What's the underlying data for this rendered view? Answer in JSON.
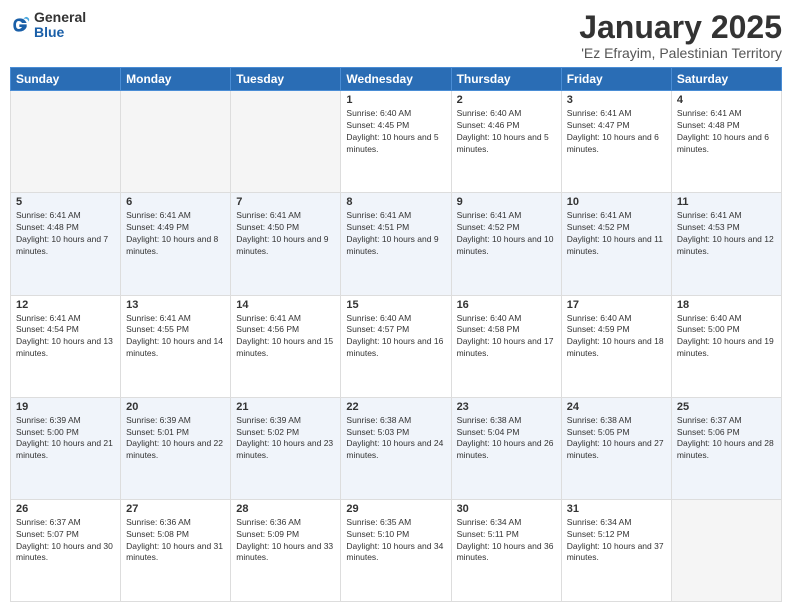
{
  "logo": {
    "general": "General",
    "blue": "Blue"
  },
  "header": {
    "title": "January 2025",
    "subtitle": "'Ez Efrayim, Palestinian Territory"
  },
  "weekdays": [
    "Sunday",
    "Monday",
    "Tuesday",
    "Wednesday",
    "Thursday",
    "Friday",
    "Saturday"
  ],
  "weeks": [
    [
      {
        "day": "",
        "sunrise": "",
        "sunset": "",
        "daylight": "",
        "empty": true
      },
      {
        "day": "",
        "sunrise": "",
        "sunset": "",
        "daylight": "",
        "empty": true
      },
      {
        "day": "",
        "sunrise": "",
        "sunset": "",
        "daylight": "",
        "empty": true
      },
      {
        "day": "1",
        "sunrise": "Sunrise: 6:40 AM",
        "sunset": "Sunset: 4:45 PM",
        "daylight": "Daylight: 10 hours and 5 minutes.",
        "empty": false
      },
      {
        "day": "2",
        "sunrise": "Sunrise: 6:40 AM",
        "sunset": "Sunset: 4:46 PM",
        "daylight": "Daylight: 10 hours and 5 minutes.",
        "empty": false
      },
      {
        "day": "3",
        "sunrise": "Sunrise: 6:41 AM",
        "sunset": "Sunset: 4:47 PM",
        "daylight": "Daylight: 10 hours and 6 minutes.",
        "empty": false
      },
      {
        "day": "4",
        "sunrise": "Sunrise: 6:41 AM",
        "sunset": "Sunset: 4:48 PM",
        "daylight": "Daylight: 10 hours and 6 minutes.",
        "empty": false
      }
    ],
    [
      {
        "day": "5",
        "sunrise": "Sunrise: 6:41 AM",
        "sunset": "Sunset: 4:48 PM",
        "daylight": "Daylight: 10 hours and 7 minutes.",
        "empty": false
      },
      {
        "day": "6",
        "sunrise": "Sunrise: 6:41 AM",
        "sunset": "Sunset: 4:49 PM",
        "daylight": "Daylight: 10 hours and 8 minutes.",
        "empty": false
      },
      {
        "day": "7",
        "sunrise": "Sunrise: 6:41 AM",
        "sunset": "Sunset: 4:50 PM",
        "daylight": "Daylight: 10 hours and 9 minutes.",
        "empty": false
      },
      {
        "day": "8",
        "sunrise": "Sunrise: 6:41 AM",
        "sunset": "Sunset: 4:51 PM",
        "daylight": "Daylight: 10 hours and 9 minutes.",
        "empty": false
      },
      {
        "day": "9",
        "sunrise": "Sunrise: 6:41 AM",
        "sunset": "Sunset: 4:52 PM",
        "daylight": "Daylight: 10 hours and 10 minutes.",
        "empty": false
      },
      {
        "day": "10",
        "sunrise": "Sunrise: 6:41 AM",
        "sunset": "Sunset: 4:52 PM",
        "daylight": "Daylight: 10 hours and 11 minutes.",
        "empty": false
      },
      {
        "day": "11",
        "sunrise": "Sunrise: 6:41 AM",
        "sunset": "Sunset: 4:53 PM",
        "daylight": "Daylight: 10 hours and 12 minutes.",
        "empty": false
      }
    ],
    [
      {
        "day": "12",
        "sunrise": "Sunrise: 6:41 AM",
        "sunset": "Sunset: 4:54 PM",
        "daylight": "Daylight: 10 hours and 13 minutes.",
        "empty": false
      },
      {
        "day": "13",
        "sunrise": "Sunrise: 6:41 AM",
        "sunset": "Sunset: 4:55 PM",
        "daylight": "Daylight: 10 hours and 14 minutes.",
        "empty": false
      },
      {
        "day": "14",
        "sunrise": "Sunrise: 6:41 AM",
        "sunset": "Sunset: 4:56 PM",
        "daylight": "Daylight: 10 hours and 15 minutes.",
        "empty": false
      },
      {
        "day": "15",
        "sunrise": "Sunrise: 6:40 AM",
        "sunset": "Sunset: 4:57 PM",
        "daylight": "Daylight: 10 hours and 16 minutes.",
        "empty": false
      },
      {
        "day": "16",
        "sunrise": "Sunrise: 6:40 AM",
        "sunset": "Sunset: 4:58 PM",
        "daylight": "Daylight: 10 hours and 17 minutes.",
        "empty": false
      },
      {
        "day": "17",
        "sunrise": "Sunrise: 6:40 AM",
        "sunset": "Sunset: 4:59 PM",
        "daylight": "Daylight: 10 hours and 18 minutes.",
        "empty": false
      },
      {
        "day": "18",
        "sunrise": "Sunrise: 6:40 AM",
        "sunset": "Sunset: 5:00 PM",
        "daylight": "Daylight: 10 hours and 19 minutes.",
        "empty": false
      }
    ],
    [
      {
        "day": "19",
        "sunrise": "Sunrise: 6:39 AM",
        "sunset": "Sunset: 5:00 PM",
        "daylight": "Daylight: 10 hours and 21 minutes.",
        "empty": false
      },
      {
        "day": "20",
        "sunrise": "Sunrise: 6:39 AM",
        "sunset": "Sunset: 5:01 PM",
        "daylight": "Daylight: 10 hours and 22 minutes.",
        "empty": false
      },
      {
        "day": "21",
        "sunrise": "Sunrise: 6:39 AM",
        "sunset": "Sunset: 5:02 PM",
        "daylight": "Daylight: 10 hours and 23 minutes.",
        "empty": false
      },
      {
        "day": "22",
        "sunrise": "Sunrise: 6:38 AM",
        "sunset": "Sunset: 5:03 PM",
        "daylight": "Daylight: 10 hours and 24 minutes.",
        "empty": false
      },
      {
        "day": "23",
        "sunrise": "Sunrise: 6:38 AM",
        "sunset": "Sunset: 5:04 PM",
        "daylight": "Daylight: 10 hours and 26 minutes.",
        "empty": false
      },
      {
        "day": "24",
        "sunrise": "Sunrise: 6:38 AM",
        "sunset": "Sunset: 5:05 PM",
        "daylight": "Daylight: 10 hours and 27 minutes.",
        "empty": false
      },
      {
        "day": "25",
        "sunrise": "Sunrise: 6:37 AM",
        "sunset": "Sunset: 5:06 PM",
        "daylight": "Daylight: 10 hours and 28 minutes.",
        "empty": false
      }
    ],
    [
      {
        "day": "26",
        "sunrise": "Sunrise: 6:37 AM",
        "sunset": "Sunset: 5:07 PM",
        "daylight": "Daylight: 10 hours and 30 minutes.",
        "empty": false
      },
      {
        "day": "27",
        "sunrise": "Sunrise: 6:36 AM",
        "sunset": "Sunset: 5:08 PM",
        "daylight": "Daylight: 10 hours and 31 minutes.",
        "empty": false
      },
      {
        "day": "28",
        "sunrise": "Sunrise: 6:36 AM",
        "sunset": "Sunset: 5:09 PM",
        "daylight": "Daylight: 10 hours and 33 minutes.",
        "empty": false
      },
      {
        "day": "29",
        "sunrise": "Sunrise: 6:35 AM",
        "sunset": "Sunset: 5:10 PM",
        "daylight": "Daylight: 10 hours and 34 minutes.",
        "empty": false
      },
      {
        "day": "30",
        "sunrise": "Sunrise: 6:34 AM",
        "sunset": "Sunset: 5:11 PM",
        "daylight": "Daylight: 10 hours and 36 minutes.",
        "empty": false
      },
      {
        "day": "31",
        "sunrise": "Sunrise: 6:34 AM",
        "sunset": "Sunset: 5:12 PM",
        "daylight": "Daylight: 10 hours and 37 minutes.",
        "empty": false
      },
      {
        "day": "",
        "sunrise": "",
        "sunset": "",
        "daylight": "",
        "empty": true
      }
    ]
  ]
}
